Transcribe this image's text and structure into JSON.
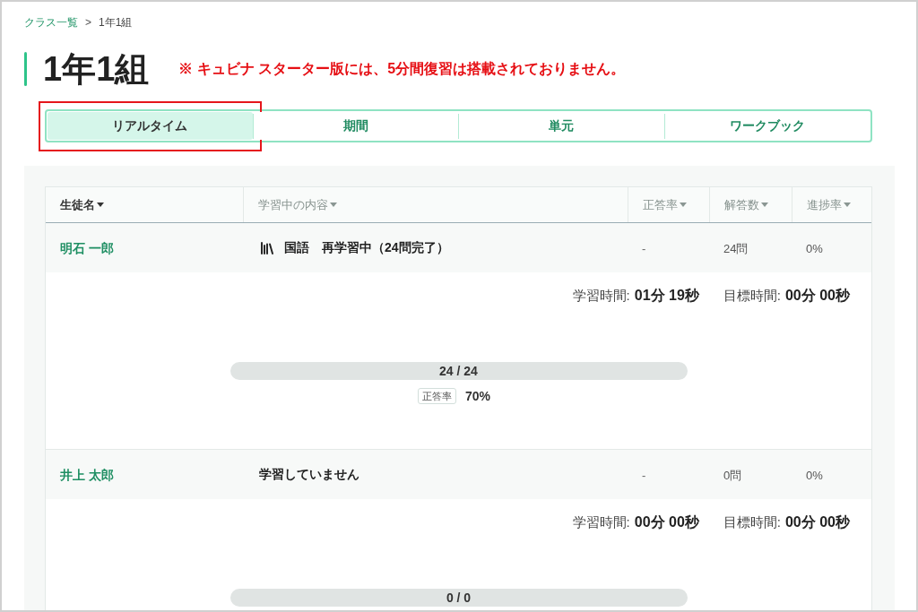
{
  "breadcrumb": {
    "items": [
      {
        "label": "クラス一覧",
        "kind": "link"
      },
      {
        "label": "1年1組",
        "kind": "current"
      }
    ],
    "separator": ">"
  },
  "page_title": "1年1組",
  "notice": "※ キュビナ スターター版には、5分間復習は搭載されておりません。",
  "tabs": [
    {
      "label": "リアルタイム",
      "selected": true,
      "highlighted": true
    },
    {
      "label": "期間",
      "selected": false,
      "highlighted": false
    },
    {
      "label": "単元",
      "selected": false,
      "highlighted": false
    },
    {
      "label": "ワークブック",
      "selected": false,
      "highlighted": false
    }
  ],
  "table": {
    "columns": [
      {
        "label": "生徒名",
        "sorted": true
      },
      {
        "label": "学習中の内容",
        "sorted": false
      },
      {
        "label": "正答率",
        "sorted": false
      },
      {
        "label": "解答数",
        "sorted": false
      },
      {
        "label": "進捗率",
        "sorted": false
      }
    ],
    "rows": [
      {
        "name": "明石 一郎",
        "has_book_icon": true,
        "content": "国語　再学習中（24問完了）",
        "accuracy": "-",
        "answers": "24問",
        "progress": "0%",
        "study_time_label": "学習時間:",
        "study_time": "01分 19秒",
        "target_time_label": "目標時間:",
        "target_time": "00分 00秒",
        "answer_count": "24 / 24",
        "accuracy_badge": "正答率",
        "accuracy_value": "70%"
      },
      {
        "name": "井上 太郎",
        "has_book_icon": false,
        "content": "学習していません",
        "accuracy": "-",
        "answers": "0問",
        "progress": "0%",
        "study_time_label": "学習時間:",
        "study_time": "00分 00秒",
        "target_time_label": "目標時間:",
        "target_time": "00分 00秒",
        "answer_count": "0 / 0"
      }
    ]
  }
}
